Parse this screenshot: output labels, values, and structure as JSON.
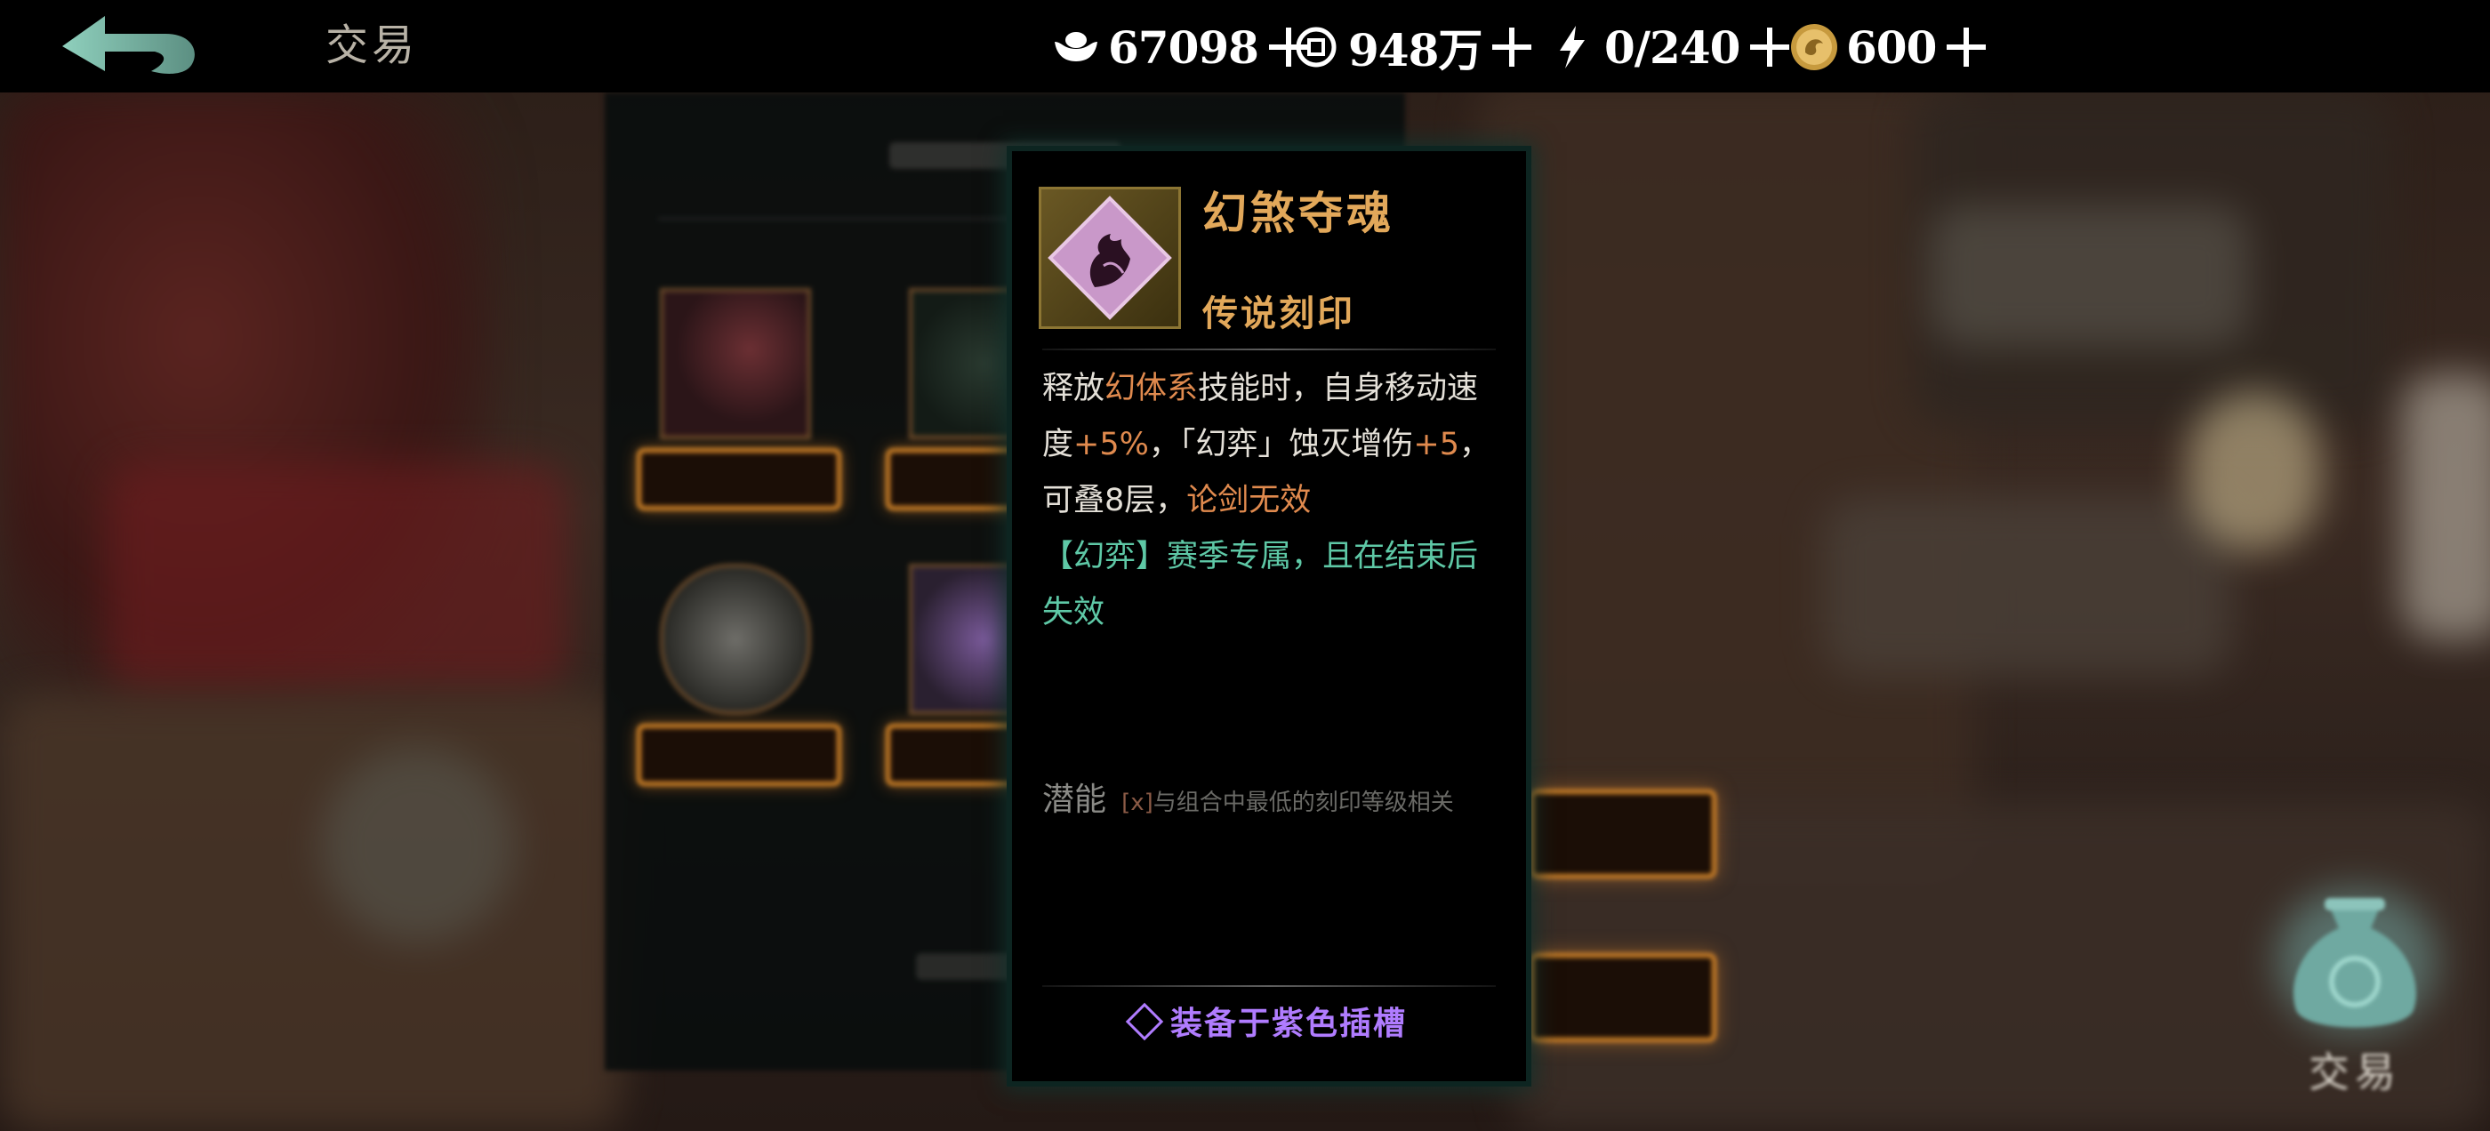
{
  "header": {
    "title": "交易",
    "currencies": [
      {
        "icon": "silver-ingot-icon",
        "value": "67098"
      },
      {
        "icon": "coin-icon",
        "value": "948万"
      },
      {
        "icon": "lightning-icon",
        "value": "0/240"
      },
      {
        "icon": "gold-dragon-coin-icon",
        "value": "600"
      }
    ]
  },
  "item_card": {
    "name": "幻煞夺魂",
    "rarity": "传说刻印",
    "description": {
      "p1": "释放",
      "p2": "幻体系",
      "p3": "技能时，自身移动速度",
      "p4": "+5%",
      "p5": "，「幻弈」蚀灭增伤",
      "p6": "+5",
      "p7": "，可叠8层，",
      "p8": "论剑无效",
      "season_note": "【幻弈】赛季专属，且在结束后失效"
    },
    "potential": {
      "label": "潜能",
      "x_marker": "[x]",
      "note": "与组合中最低的刻印等级相关"
    },
    "slot_text": "装备于紫色插槽"
  },
  "trade_button": {
    "label": "交易"
  },
  "colors": {
    "accent_orange": "#e2a85a",
    "highlight_orange": "#e08a4e",
    "season_cyan": "#5ec8a6",
    "slot_purple": "#b07cff"
  }
}
